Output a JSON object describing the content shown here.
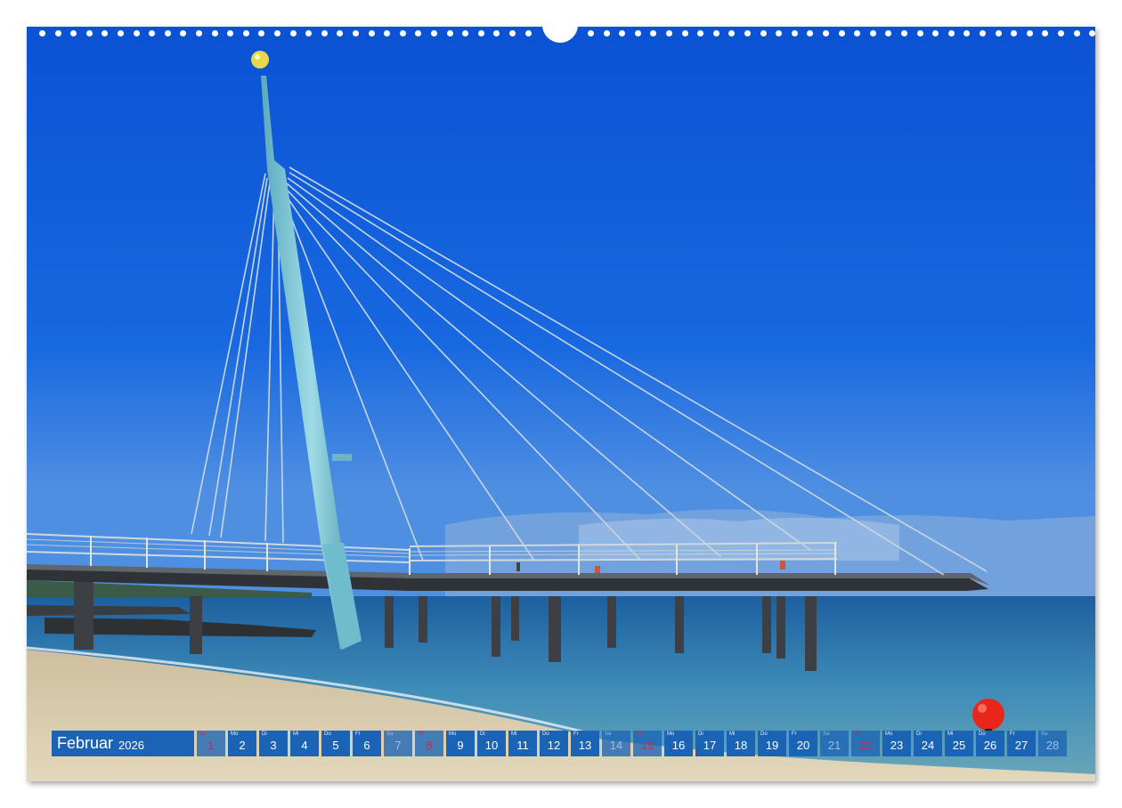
{
  "calendar": {
    "month": "Februar",
    "year": "2026",
    "days": [
      {
        "wd": "So",
        "num": "1",
        "type": "sun"
      },
      {
        "wd": "Mo",
        "num": "2",
        "type": "week"
      },
      {
        "wd": "Di",
        "num": "3",
        "type": "week"
      },
      {
        "wd": "Mi",
        "num": "4",
        "type": "week"
      },
      {
        "wd": "Do",
        "num": "5",
        "type": "week"
      },
      {
        "wd": "Fr",
        "num": "6",
        "type": "week"
      },
      {
        "wd": "Sa",
        "num": "7",
        "type": "sat"
      },
      {
        "wd": "So",
        "num": "8",
        "type": "sun"
      },
      {
        "wd": "Mo",
        "num": "9",
        "type": "week"
      },
      {
        "wd": "Di",
        "num": "10",
        "type": "week"
      },
      {
        "wd": "Mi",
        "num": "11",
        "type": "week"
      },
      {
        "wd": "Do",
        "num": "12",
        "type": "week"
      },
      {
        "wd": "Fr",
        "num": "13",
        "type": "week"
      },
      {
        "wd": "Sa",
        "num": "14",
        "type": "sat"
      },
      {
        "wd": "So",
        "num": "15",
        "type": "sun"
      },
      {
        "wd": "Mo",
        "num": "16",
        "type": "week"
      },
      {
        "wd": "Di",
        "num": "17",
        "type": "week"
      },
      {
        "wd": "Mi",
        "num": "18",
        "type": "week"
      },
      {
        "wd": "Do",
        "num": "19",
        "type": "week"
      },
      {
        "wd": "Fr",
        "num": "20",
        "type": "week"
      },
      {
        "wd": "Sa",
        "num": "21",
        "type": "sat"
      },
      {
        "wd": "So",
        "num": "22",
        "type": "sun"
      },
      {
        "wd": "Mo",
        "num": "23",
        "type": "week"
      },
      {
        "wd": "Di",
        "num": "24",
        "type": "week"
      },
      {
        "wd": "Mi",
        "num": "25",
        "type": "week"
      },
      {
        "wd": "Do",
        "num": "26",
        "type": "week"
      },
      {
        "wd": "Fr",
        "num": "27",
        "type": "week"
      },
      {
        "wd": "Sa",
        "num": "28",
        "type": "sat"
      }
    ]
  },
  "colors": {
    "sky": "#0f5fd8",
    "cell": "#1b64b5",
    "sunday": "#c0304a",
    "buoy": "#e8261b",
    "pylon": "#7cc6d6"
  }
}
